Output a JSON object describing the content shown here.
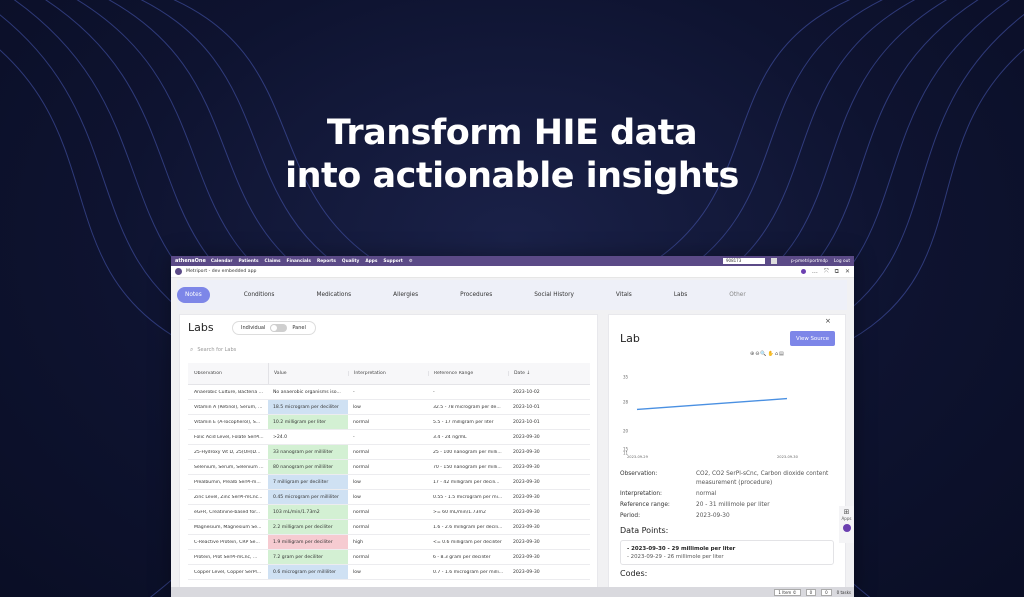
{
  "headline": {
    "line1": "Transform HIE data",
    "line2": "into actionable insights"
  },
  "app": {
    "topbar": {
      "brand": "athenaOne",
      "nav": [
        "Calendar",
        "Patients",
        "Claims",
        "Financials",
        "Reports",
        "Quality",
        "Apps",
        "Support"
      ],
      "patient_id": "908173",
      "user": "p-pmetriportmdp",
      "logout": "Log out"
    },
    "titlebar": {
      "title": "Metriport - dev embedded app"
    },
    "tabs": [
      "Notes",
      "Conditions",
      "Medications",
      "Allergies",
      "Procedures",
      "Social History",
      "Vitals",
      "Labs",
      "Other"
    ],
    "labs": {
      "title": "Labs",
      "toggle_left": "Individual",
      "toggle_right": "Panel",
      "search_placeholder": "Search for Labs",
      "columns": [
        "Observation",
        "Value",
        "Interpretation",
        "Reference Range",
        "Date ↓"
      ],
      "rows": [
        {
          "obs": "Anaerobic Culture, Bacteria ...",
          "value": "No anaerobic organisms iso...",
          "interp": "-",
          "range": "-",
          "date": "2023-10-02",
          "tone": ""
        },
        {
          "obs": "Vitamin A (Retinol), Serum, ...",
          "value": "18.5 microgram per deciliter",
          "interp": "low",
          "range": "32.5 - 78 microgram per de...",
          "date": "2023-10-01",
          "tone": "blue"
        },
        {
          "obs": "Vitamin E (A-Tocopherol), S...",
          "value": "10.2 milligram per liter",
          "interp": "normal",
          "range": "5.5 - 17 milligram per liter",
          "date": "2023-10-01",
          "tone": "green"
        },
        {
          "obs": "Folic Acid Level, Folate SerPl...",
          "value": ">24.0",
          "interp": "-",
          "range": "3.4 - 24 ng/mL",
          "date": "2023-09-30",
          "tone": ""
        },
        {
          "obs": "25-Hydroxy Vit D, 25(OH)D...",
          "value": "33 nanogram per milliliter",
          "interp": "normal",
          "range": "25 - 100 nanogram per milli...",
          "date": "2023-09-30",
          "tone": "green"
        },
        {
          "obs": "Selenium, Serum, Selenium ...",
          "value": "80 nanogram per milliliter",
          "interp": "normal",
          "range": "70 - 150 nanogram per milli...",
          "date": "2023-09-30",
          "tone": "green"
        },
        {
          "obs": "Prealbumin, Prealb SerPl-m...",
          "value": "7 milligram per deciliter",
          "interp": "low",
          "range": "17 - 42 milligram per decili...",
          "date": "2023-09-30",
          "tone": "blue"
        },
        {
          "obs": "Zinc Level, Zinc SerPl-mCnc...",
          "value": "0.45 microgram per milliliter",
          "interp": "low",
          "range": "0.55 - 1.5 microgram per mi...",
          "date": "2023-09-30",
          "tone": "blue"
        },
        {
          "obs": "eGFR, Creatinine-based for...",
          "value": "103 mL/min/1.73m2",
          "interp": "normal",
          "range": ">= 60 mL/min/1.73m2",
          "date": "2023-09-30",
          "tone": "green"
        },
        {
          "obs": "Magnesium, Magnesium Se...",
          "value": "2.2 milligram per deciliter",
          "interp": "normal",
          "range": "1.6 - 2.6 milligram per decili...",
          "date": "2023-09-30",
          "tone": "green"
        },
        {
          "obs": "C-Reactive Protein, CRP Se...",
          "value": "1.9 milligram per deciliter",
          "interp": "high",
          "range": "<= 0.6 milligram per deciliter",
          "date": "2023-09-30",
          "tone": "red"
        },
        {
          "obs": "Protein, Prot SerPl-mCnc, ...",
          "value": "7.2 gram per deciliter",
          "interp": "normal",
          "range": "6 - 8.3 gram per deciliter",
          "date": "2023-09-30",
          "tone": "green"
        },
        {
          "obs": "Copper Level, Copper SerPl...",
          "value": "0.6 microgram per milliliter",
          "interp": "low",
          "range": "0.7 - 1.6 microgram per milli...",
          "date": "2023-09-30",
          "tone": "blue"
        }
      ]
    },
    "lab_detail": {
      "close": "×",
      "title": "Lab",
      "view_source": "View Source",
      "fields": [
        {
          "k": "Observation:",
          "v": "CO2, CO2 SerPl-sCnc, Carbon dioxide content measurement (procedure)"
        },
        {
          "k": "Interpretation:",
          "v": "normal"
        },
        {
          "k": "Reference range:",
          "v": "20 - 31 millimole per liter"
        },
        {
          "k": "Period:",
          "v": "2023-09-30"
        }
      ],
      "data_points_title": "Data Points:",
      "data_points": [
        "- 2023-09-30 - 29 millimole per liter",
        "- 2023-09-29 - 26 millimole per liter"
      ],
      "codes_title": "Codes:"
    },
    "side_apps": {
      "label": "Apps"
    },
    "statusbar": {
      "items": [
        "1 Item ©",
        "0",
        "0",
        "0 tasks"
      ]
    }
  },
  "chart_data": {
    "type": "line",
    "x": [
      "2023-09-29",
      "2023-09-30"
    ],
    "series": [
      {
        "values": [
          26,
          29
        ]
      }
    ],
    "ylim": [
      15,
      35
    ],
    "yticks": [
      35,
      28,
      20,
      15,
      11
    ],
    "xticks": [
      "2023-09-29",
      "2023-09-30"
    ],
    "color": "#4a90e2",
    "grid": false
  }
}
